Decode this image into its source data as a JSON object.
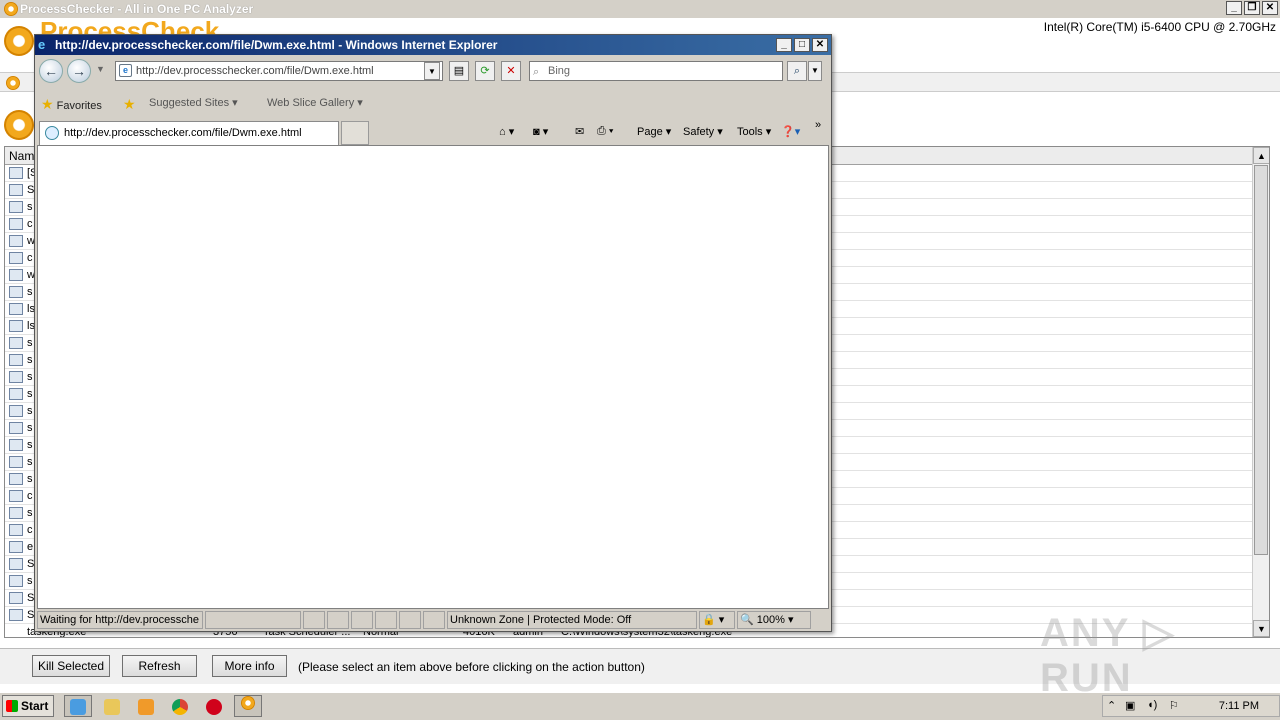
{
  "pc": {
    "title": "ProcessChecker - All in One PC Analyzer",
    "cpu": "Intel(R) Core(TM) i5-6400 CPU @ 2.70GHz",
    "logo_text": "ProcessCheck",
    "table_header": "Nam",
    "rows": [
      {
        "name": "[S"
      },
      {
        "name": "S"
      },
      {
        "name": "s"
      },
      {
        "name": "c"
      },
      {
        "name": "w"
      },
      {
        "name": "c"
      },
      {
        "name": "w"
      },
      {
        "name": "s"
      },
      {
        "name": "ls"
      },
      {
        "name": "ls"
      },
      {
        "name": "s"
      },
      {
        "name": "s"
      },
      {
        "name": "s"
      },
      {
        "name": "s"
      },
      {
        "name": "s"
      },
      {
        "name": "s"
      },
      {
        "name": "s"
      },
      {
        "name": "s"
      },
      {
        "name": "s"
      },
      {
        "name": "c"
      },
      {
        "name": "s"
      },
      {
        "name": "c"
      },
      {
        "name": "e"
      },
      {
        "name": "S"
      },
      {
        "name": "s"
      },
      {
        "name": "S"
      },
      {
        "name": "S"
      }
    ],
    "last_row": {
      "name": "taskeng.exe",
      "pid": "3756",
      "desc": "Task Scheduler ...",
      "priority": "Normal",
      "mem": "4016K",
      "user": "admin",
      "path": "C:\\Windows\\system32\\taskeng.exe"
    },
    "buttons": {
      "kill": "Kill Selected",
      "refresh": "Refresh",
      "more": "More info"
    },
    "hint": "(Please select an item above before clicking on the action button)"
  },
  "ie": {
    "title": "http://dev.processchecker.com/file/Dwm.exe.html - Windows Internet Explorer",
    "address": "http://dev.processchecker.com/file/Dwm.exe.html",
    "search_placeholder": "Bing",
    "favorites": "Favorites",
    "suggested": "Suggested Sites",
    "web_slice": "Web Slice Gallery",
    "tab_title": "http://dev.processchecker.com/file/Dwm.exe.html",
    "cmd": {
      "page": "Page",
      "safety": "Safety",
      "tools": "Tools"
    },
    "status": {
      "text": "Waiting for http://dev.processche",
      "zone": "Unknown Zone | Protected Mode: Off",
      "zoom": "100%"
    }
  },
  "taskbar": {
    "start": "Start",
    "clock": "7:11 PM"
  },
  "watermark": "ANY RUN"
}
